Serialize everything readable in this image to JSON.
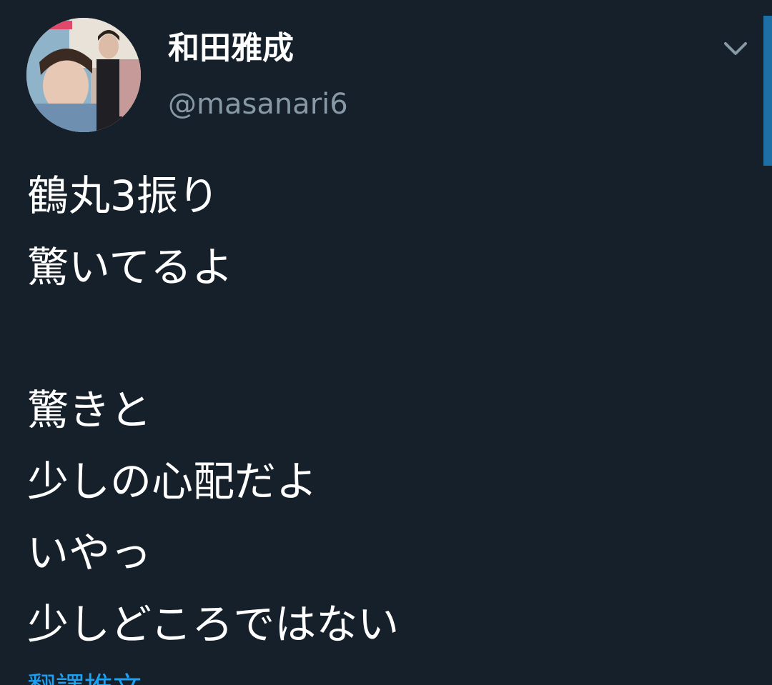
{
  "user": {
    "display_name": "和田雅成",
    "handle": "@masanari6",
    "avatar_icon": "profile-photo-icon"
  },
  "tweet": {
    "lines": [
      "鶴丸3振り",
      "驚いてるよ",
      "",
      "驚きと",
      "少しの心配だよ",
      "いやっ",
      "少しどころではない"
    ]
  },
  "actions": {
    "translate_label": "翻譯推文",
    "menu_icon": "chevron-down-icon"
  },
  "colors": {
    "background": "#15202b",
    "text_primary": "#ffffff",
    "text_secondary": "#8899a6",
    "link": "#1da1f2",
    "scrollbar": "#1d6fa5"
  }
}
